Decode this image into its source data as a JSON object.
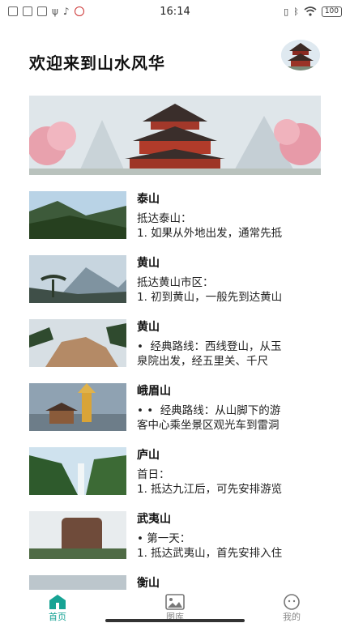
{
  "status_bar": {
    "time": "16:14",
    "battery": "100",
    "left_icons": [
      "doc-icon",
      "doc-icon",
      "app-icon",
      "usb-icon",
      "tiktok-icon",
      "app-icon"
    ],
    "right_icons": [
      "vibrate-icon",
      "bluetooth-icon",
      "wifi-icon",
      "battery-icon"
    ]
  },
  "header": {
    "title": "欢迎来到山水风华"
  },
  "list": [
    {
      "title": "泰山",
      "desc": "抵达泰山：\n1. 如果从外地出发，通常先抵"
    },
    {
      "title": "黄山",
      "desc": "抵达黄山市区：\n1. 初到黄山，一般先到达黄山"
    },
    {
      "title": "黄山",
      "desc": "•  经典路线：西线登山，从玉\n泉院出发，经五里关、千尺"
    },
    {
      "title": "峨眉山",
      "desc": "• •  经典路线：从山脚下的游\n客中心乘坐景区观光车到雷洞"
    },
    {
      "title": "庐山",
      "desc": "首日：\n1. 抵达九江后，可先安排游览"
    },
    {
      "title": "武夷山",
      "desc": "• 第一天：\n1. 抵达武夷山，首先安排入住"
    },
    {
      "title": "衡山",
      "desc": ""
    }
  ],
  "bottom_nav": [
    {
      "label": "首页",
      "icon": "home-icon",
      "active": true
    },
    {
      "label": "图库",
      "icon": "gallery-icon",
      "active": false
    },
    {
      "label": "我的",
      "icon": "profile-icon",
      "active": false
    }
  ],
  "colors": {
    "accent": "#16a394",
    "inactive": "#888888"
  }
}
